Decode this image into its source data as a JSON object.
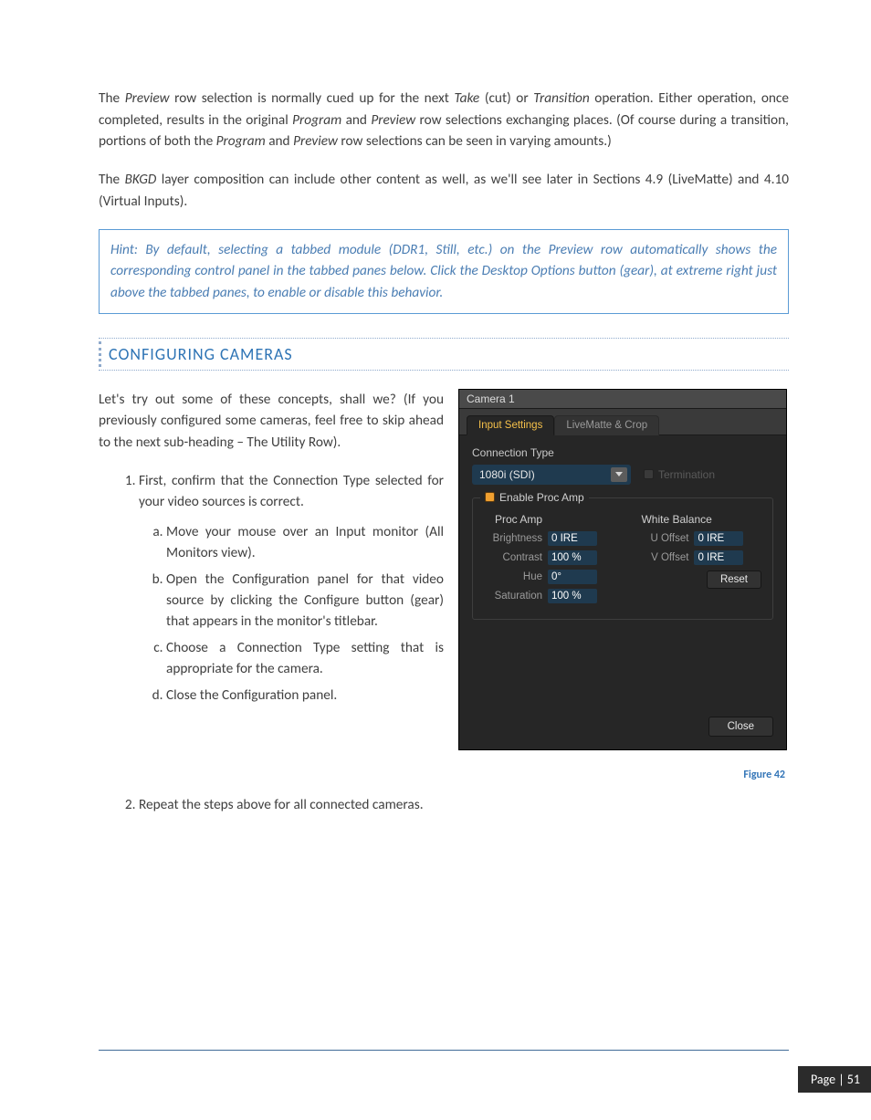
{
  "para1_html": "The <span class='it'>Preview</span> row selection is normally cued up for the next <span class='it'>Take</span> (cut) or <span class='it'>Transition</span> operation. Either operation, once completed, results in the original <span class='it'>Program</span> and <span class='it'>Preview</span> row selections exchanging places. (Of course during a transition, portions of both the <span class='it'>Program</span> and <span class='it'>Preview</span> row selections can be seen in varying amounts.)",
  "para2_html": "The <span class='it'>BKGD</span> layer composition can include other content as well, as we'll see later in Sections 4.9 (LiveMatte) and 4.10 (Virtual Inputs).",
  "hint": "Hint: By default, selecting a tabbed module (DDR1, Still, etc.) on the Preview row automatically shows the corresponding control panel in the tabbed panes below. Click the Desktop Options button (gear), at extreme right just above the tabbed panes, to enable or disable this behavior.",
  "section_heading": "CONFIGURING CAMERAS",
  "intro": "Let's try out some of these concepts, shall we? (If you previously configured some cameras, feel free to skip ahead to the next sub-heading – The Utility Row).",
  "list1": {
    "item1_html": "First, confirm that the <span class='it'>Connection Type</span> selected for your video sources is correct.",
    "a_html": "Move your mouse over an <span class='it'>Input</span> monitor (<span class='it'>All Monitors</span> view).",
    "b_html": "Open the <span class='it'>Configuration</span> panel for that video source by clicking the <span class='it'>Configure button</span> (gear) that appears in the monitor's titlebar.",
    "c_html": "Choose a <span class='it'>Connection Type</span> setting that is appropriate for the camera.",
    "d_html": "Close the <span class='it'>Configuration</span> panel."
  },
  "list2": {
    "item2": "Repeat the steps above for all connected cameras."
  },
  "dialog": {
    "title": "Camera 1",
    "tab_active": "Input Settings",
    "tab_inactive": "LiveMatte & Crop",
    "connection_type_label": "Connection Type",
    "connection_value": "1080i (SDI)",
    "termination_label": "Termination",
    "group_legend": "Enable Proc Amp",
    "colA_heading": "Proc Amp",
    "colB_heading": "White Balance",
    "brightness_label": "Brightness",
    "brightness_value": "0 IRE",
    "contrast_label": "Contrast",
    "contrast_value": "100 %",
    "hue_label": "Hue",
    "hue_value": "0°",
    "saturation_label": "Saturation",
    "saturation_value": "100 %",
    "uoffset_label": "U Offset",
    "uoffset_value": "0 IRE",
    "voffset_label": "V Offset",
    "voffset_value": "0 IRE",
    "reset_label": "Reset",
    "close_label": "Close"
  },
  "caption": "Figure 42",
  "footer": "Page | 51"
}
